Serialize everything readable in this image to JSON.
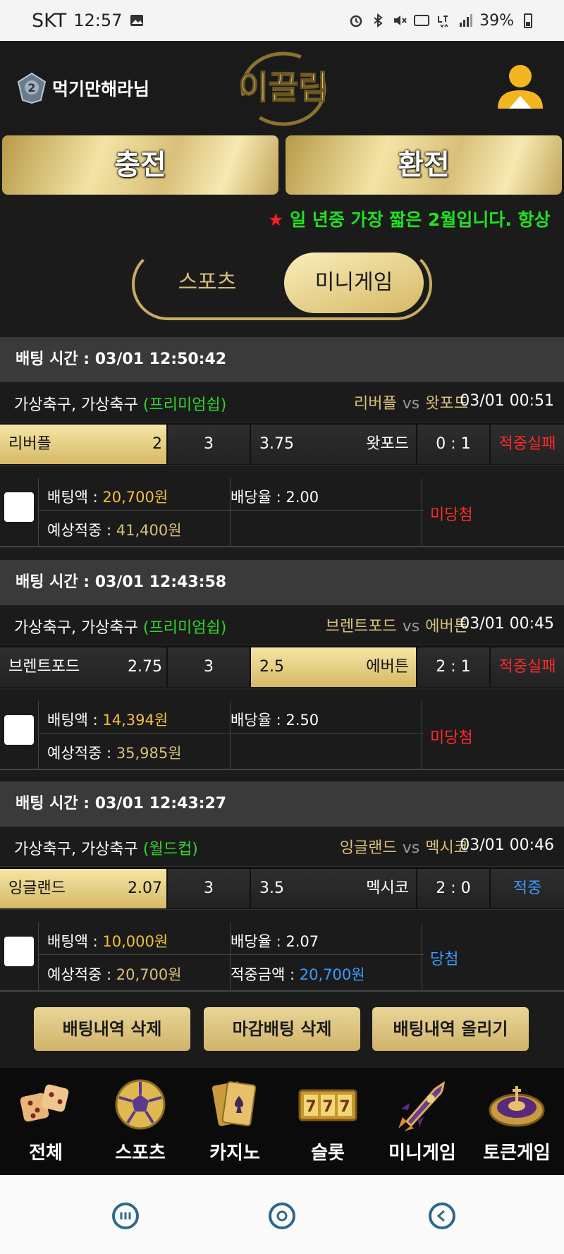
{
  "statusbar": {
    "carrier": "SKT",
    "time": "12:57",
    "battery": "39%"
  },
  "header": {
    "username": "먹기만해라님",
    "logo_text": "이끌림"
  },
  "buttons": {
    "charge": "충전",
    "exchange": "환전"
  },
  "notice": {
    "star": "★",
    "text": " 일 년중 가장 짧은 2월입니다. 항상"
  },
  "tabs": {
    "sports": "스포츠",
    "minigame": "미니게임"
  },
  "labels": {
    "bet_amount": "배팅액 : ",
    "odds": "배당율 : ",
    "expected": "예상적중 : ",
    "win_amount": "적중금액 : ",
    "vs": "vs"
  },
  "bets": [
    {
      "bet_time": "배팅 시간 : 03/01 12:50:42",
      "league": "가상축구, 가상축구 ",
      "league_tag": "(프리미엄쉽)",
      "home": "리버플",
      "away": "왓포드",
      "game_time": "03/01 00:51",
      "home_odds": "2",
      "draw": "3",
      "away_odds": "3.75",
      "score": "0 : 1",
      "result": "적중실패",
      "bet_amount": "20,700원",
      "odds": "2.00",
      "expected": "41,400원",
      "win_amount": "",
      "status": "미당첨"
    },
    {
      "bet_time": "배팅 시간 : 03/01 12:43:58",
      "league": "가상축구, 가상축구 ",
      "league_tag": "(프리미엄쉽)",
      "home": "브렌트포드",
      "away": "에버튼",
      "game_time": "03/01 00:45",
      "home_odds": "2.75",
      "draw": "3",
      "away_odds": "2.5",
      "score": "2 : 1",
      "result": "적중실패",
      "bet_amount": "14,394원",
      "odds": "2.50",
      "expected": "35,985원",
      "win_amount": "",
      "status": "미당첨"
    },
    {
      "bet_time": "배팅 시간 : 03/01 12:43:27",
      "league": "가상축구, 가상축구 ",
      "league_tag": "(월드컵)",
      "home": "잉글랜드",
      "away": "멕시코",
      "game_time": "03/01 00:46",
      "home_odds": "2.07",
      "draw": "3",
      "away_odds": "3.5",
      "score": "2 : 0",
      "result": "적중",
      "bet_amount": "10,000원",
      "odds": "2.07",
      "expected": "20,700원",
      "win_amount": "20,700원",
      "status": "당첨"
    }
  ],
  "actions": {
    "delete_history": "배팅내역 삭제",
    "delete_closed": "마감배팅 삭제",
    "upload_history": "배팅내역 올리기"
  },
  "nav": [
    {
      "label": "전체",
      "icon": "dice-icon"
    },
    {
      "label": "스포츠",
      "icon": "soccer-ball-icon"
    },
    {
      "label": "카지노",
      "icon": "playing-cards-icon"
    },
    {
      "label": "슬롯",
      "icon": "slot-777-icon"
    },
    {
      "label": "미니게임",
      "icon": "rocket-icon"
    },
    {
      "label": "토큰게임",
      "icon": "roulette-icon"
    }
  ],
  "colors": {
    "gold": "#d9bf7a",
    "green": "#22e022",
    "fail_red": "#ff2a2a",
    "win_blue": "#3b9cff"
  }
}
